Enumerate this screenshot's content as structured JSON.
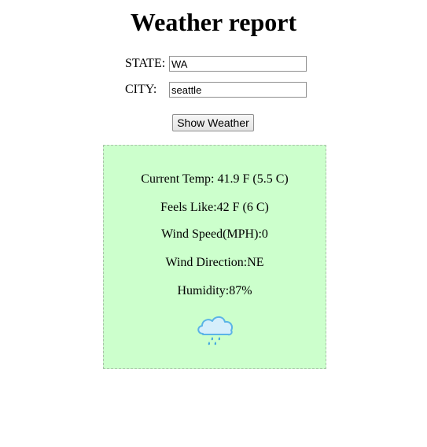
{
  "page": {
    "title": "Weather report"
  },
  "form": {
    "state_label": "STATE:",
    "state_value": "WA",
    "city_label": "CITY:",
    "city_value": "seattle",
    "submit_label": "Show Weather"
  },
  "report": {
    "current_temp": "Current Temp: 41.9 F (5.5 C)",
    "feels_like": "Feels Like:42 F (6 C)",
    "wind_speed": "Wind Speed(MPH):0",
    "wind_direction": "Wind Direction:NE",
    "humidity": "Humidity:87%",
    "icon": "rain-cloud-icon"
  },
  "colors": {
    "report_background": "#ccffcc",
    "icon_cloud": "#bfe3f7",
    "icon_outline": "#5bb3e6"
  }
}
